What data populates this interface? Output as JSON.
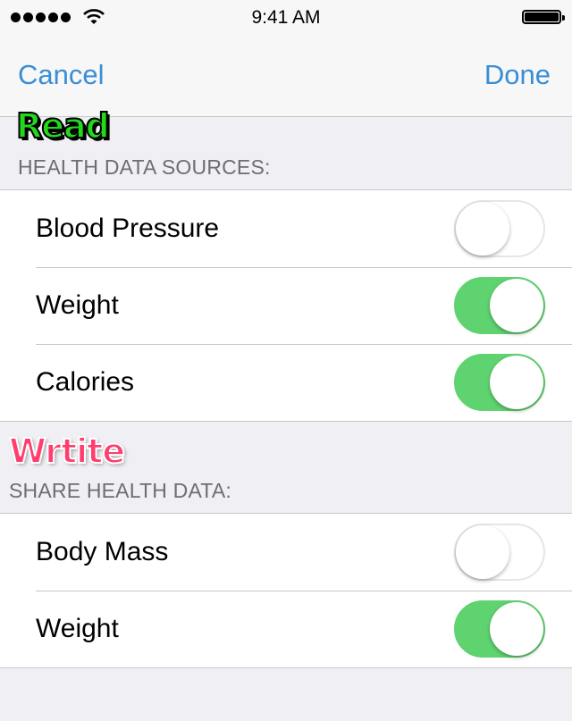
{
  "status_bar": {
    "time": "9:41 AM"
  },
  "nav": {
    "cancel_label": "Cancel",
    "done_label": "Done"
  },
  "stickers": {
    "read": "Read",
    "write": "Wrtite"
  },
  "sections": [
    {
      "header": "HEALTH DATA SOURCES:",
      "rows": [
        {
          "label": "Blood Pressure",
          "enabled": false
        },
        {
          "label": "Weight",
          "enabled": true
        },
        {
          "label": "Calories",
          "enabled": true
        }
      ]
    },
    {
      "header": "SHARE HEALTH DATA:",
      "rows": [
        {
          "label": "Body Mass",
          "enabled": false
        },
        {
          "label": "Weight",
          "enabled": true
        }
      ]
    }
  ],
  "colors": {
    "accent": "#3a8ed5",
    "toggle_on": "#5fd36f",
    "read_sticker": "#22d81a",
    "write_sticker": "#ff3d6e"
  },
  "icons": [
    "signal-dots-icon",
    "wifi-icon",
    "battery-icon"
  ]
}
